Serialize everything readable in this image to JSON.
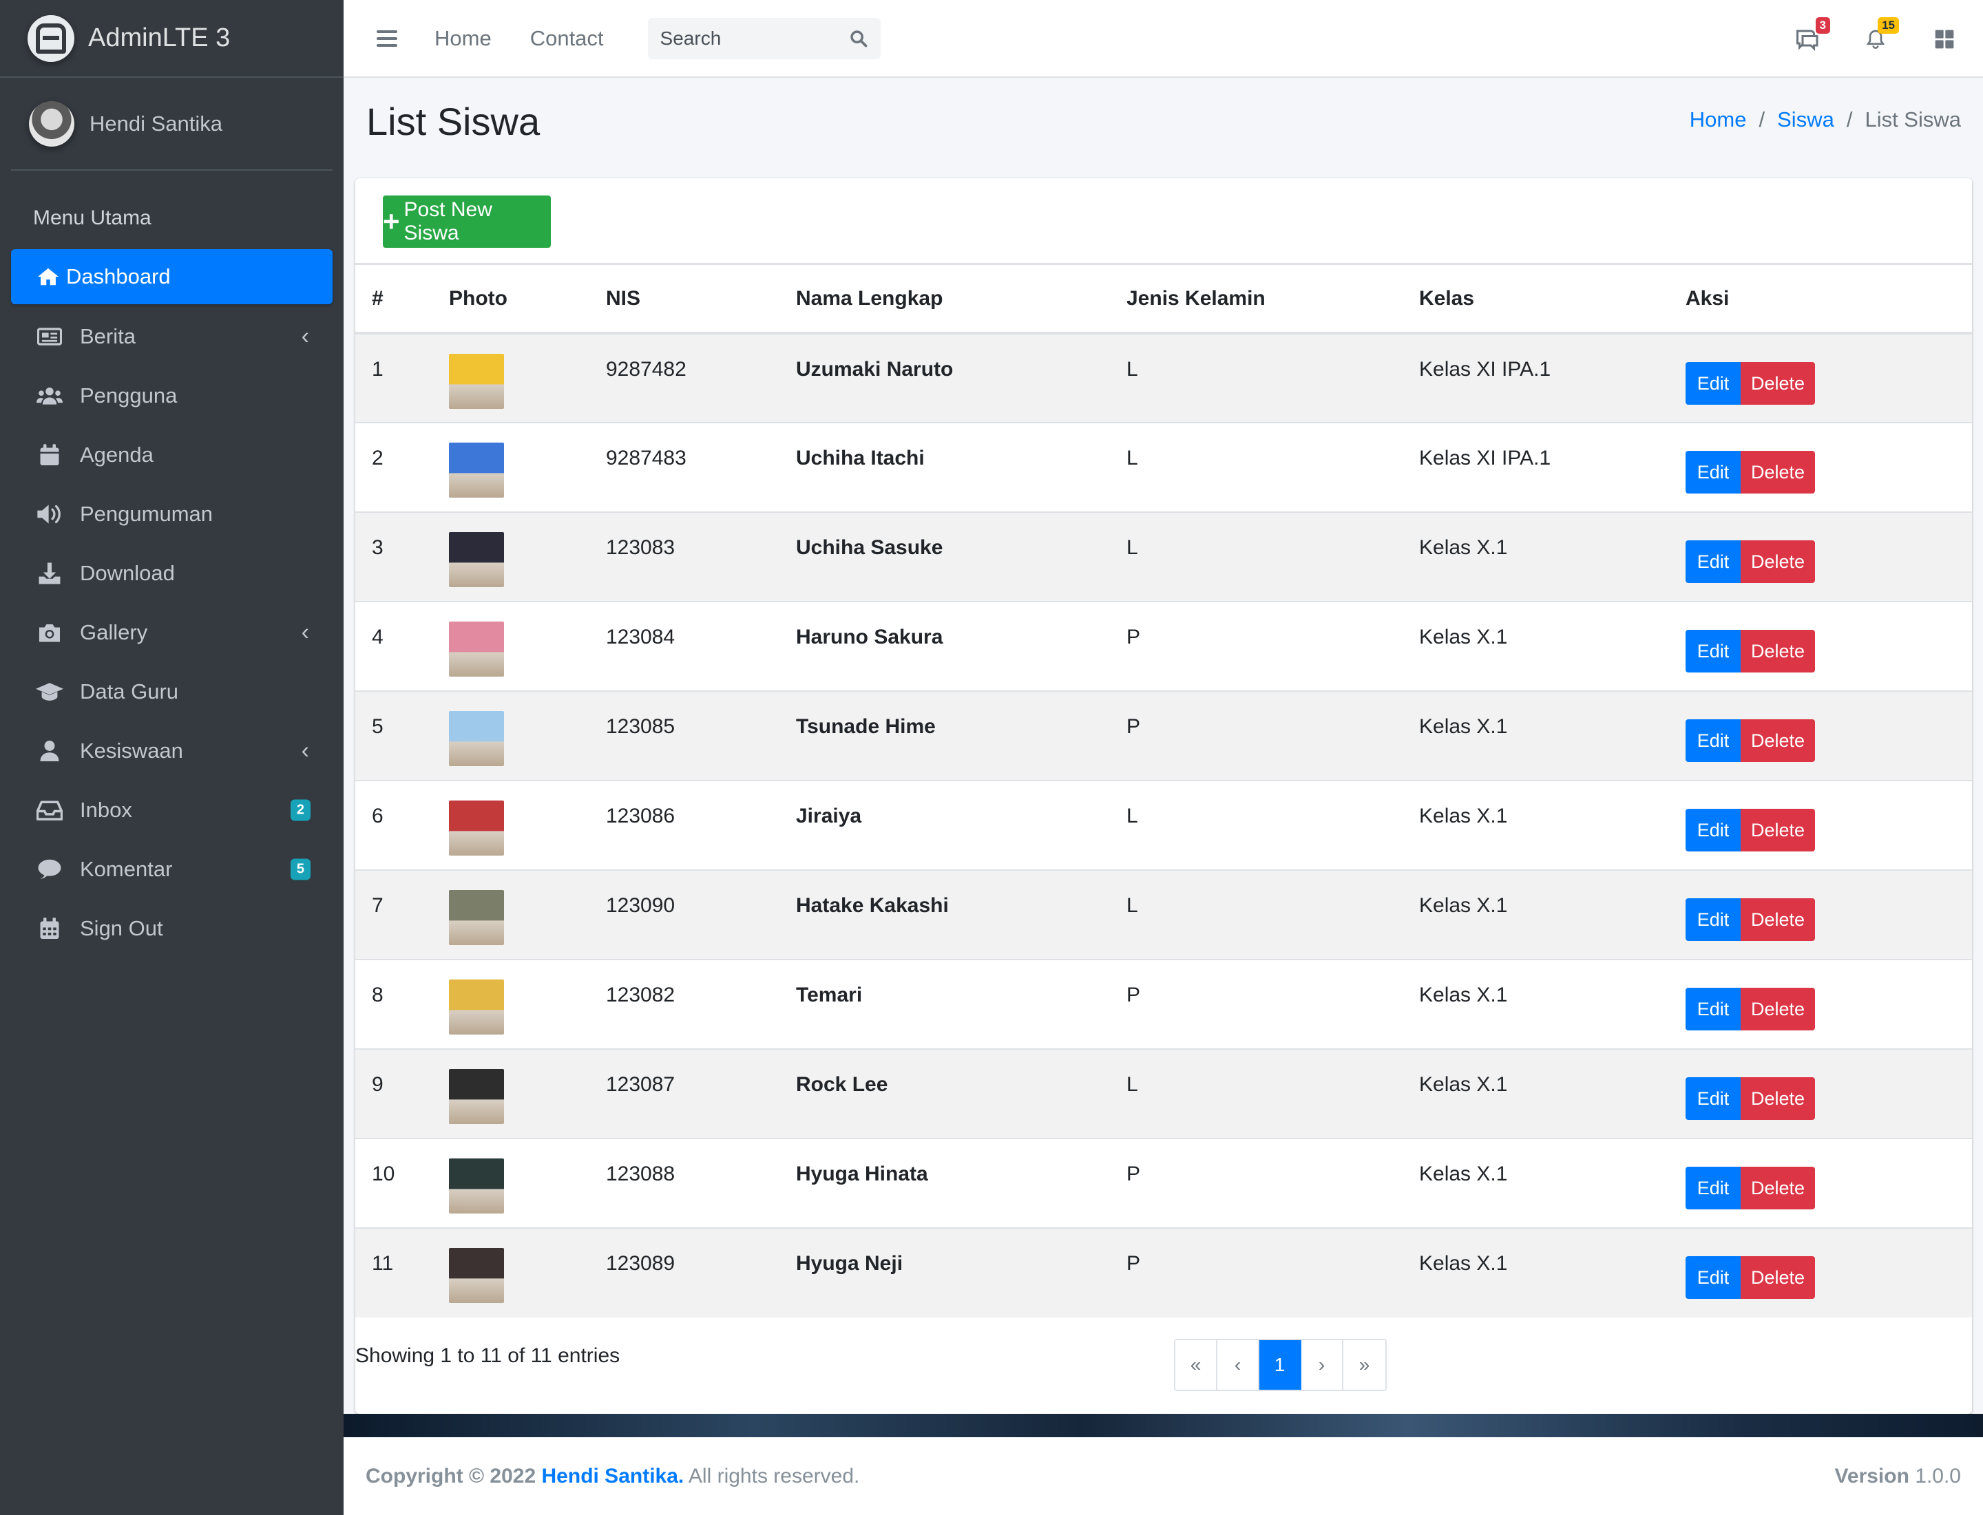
{
  "brand": {
    "name": "AdminLTE 3"
  },
  "user": {
    "name": "Hendi Santika"
  },
  "sidebar": {
    "header": "Menu Utama",
    "items": [
      {
        "label": "Dashboard",
        "icon": "home-icon",
        "active": true
      },
      {
        "label": "Berita",
        "icon": "newspaper-icon",
        "has_children": true
      },
      {
        "label": "Pengguna",
        "icon": "users-icon"
      },
      {
        "label": "Agenda",
        "icon": "calendar-icon"
      },
      {
        "label": "Pengumuman",
        "icon": "volume-icon"
      },
      {
        "label": "Download",
        "icon": "download-icon"
      },
      {
        "label": "Gallery",
        "icon": "camera-icon",
        "has_children": true
      },
      {
        "label": "Data Guru",
        "icon": "graduation-cap-icon"
      },
      {
        "label": "Kesiswaan",
        "icon": "user-icon",
        "has_children": true
      },
      {
        "label": "Inbox",
        "icon": "inbox-icon",
        "badge": "2"
      },
      {
        "label": "Komentar",
        "icon": "comment-icon",
        "badge": "5"
      },
      {
        "label": "Sign Out",
        "icon": "calendar-grid-icon"
      }
    ]
  },
  "navbar": {
    "links": [
      "Home",
      "Contact"
    ],
    "search_placeholder": "Search",
    "messages_badge": "3",
    "notifications_badge": "15"
  },
  "page": {
    "title": "List Siswa"
  },
  "breadcrumb": {
    "home": "Home",
    "section": "Siswa",
    "current": "List Siswa"
  },
  "card": {
    "post_button": "Post New Siswa"
  },
  "table": {
    "headers": [
      "#",
      "Photo",
      "NIS",
      "Nama Lengkap",
      "Jenis Kelamin",
      "Kelas",
      "Aksi"
    ],
    "edit_label": "Edit",
    "delete_label": "Delete",
    "rows": [
      {
        "no": "1",
        "nis": "9287482",
        "nama": "Uzumaki Naruto",
        "jk": "L",
        "kelas": "Kelas XI IPA.1",
        "photo_color": "#f1c232"
      },
      {
        "no": "2",
        "nis": "9287483",
        "nama": "Uchiha Itachi",
        "jk": "L",
        "kelas": "Kelas XI IPA.1",
        "photo_color": "#3d78d8"
      },
      {
        "no": "3",
        "nis": "123083",
        "nama": "Uchiha Sasuke",
        "jk": "L",
        "kelas": "Kelas X.1",
        "photo_color": "#2b2b3a"
      },
      {
        "no": "4",
        "nis": "123084",
        "nama": "Haruno Sakura",
        "jk": "P",
        "kelas": "Kelas X.1",
        "photo_color": "#e28aa0"
      },
      {
        "no": "5",
        "nis": "123085",
        "nama": "Tsunade Hime",
        "jk": "P",
        "kelas": "Kelas X.1",
        "photo_color": "#9ec9ea"
      },
      {
        "no": "6",
        "nis": "123086",
        "nama": "Jiraiya",
        "jk": "L",
        "kelas": "Kelas X.1",
        "photo_color": "#c23a3a"
      },
      {
        "no": "7",
        "nis": "123090",
        "nama": "Hatake Kakashi",
        "jk": "L",
        "kelas": "Kelas X.1",
        "photo_color": "#7b7f6a"
      },
      {
        "no": "8",
        "nis": "123082",
        "nama": "Temari",
        "jk": "P",
        "kelas": "Kelas X.1",
        "photo_color": "#e3b844"
      },
      {
        "no": "9",
        "nis": "123087",
        "nama": "Rock Lee",
        "jk": "L",
        "kelas": "Kelas X.1",
        "photo_color": "#2d2d2d"
      },
      {
        "no": "10",
        "nis": "123088",
        "nama": "Hyuga Hinata",
        "jk": "P",
        "kelas": "Kelas X.1",
        "photo_color": "#2a3b3a"
      },
      {
        "no": "11",
        "nis": "123089",
        "nama": "Hyuga Neji",
        "jk": "P",
        "kelas": "Kelas X.1",
        "photo_color": "#3b3231"
      }
    ]
  },
  "pagination": {
    "info": "Showing 1 to 11 of 11 entries",
    "first": "«",
    "prev": "‹",
    "current": "1",
    "next": "›",
    "last": "»"
  },
  "footer": {
    "copyright_prefix": "Copyright © 2022",
    "author": "Hendi Santika.",
    "rights": "All rights reserved.",
    "version_label": "Version",
    "version_value": "1.0.0"
  },
  "colors": {
    "primary": "#007bff",
    "success": "#28a745",
    "danger": "#dc3545",
    "info": "#17a2b8",
    "warning": "#ffc107",
    "sidebar": "#343a40"
  }
}
